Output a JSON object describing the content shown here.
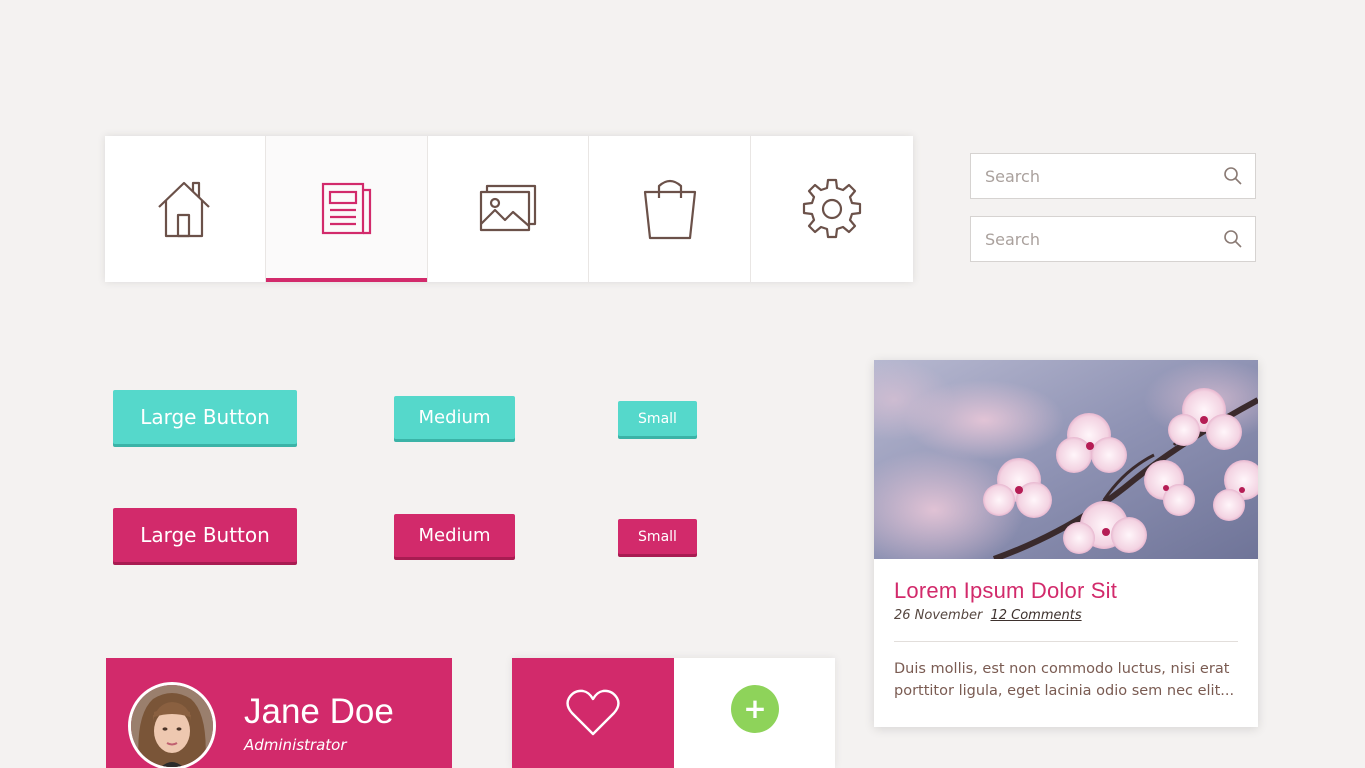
{
  "nav": {
    "accent_color": "#d22a6b",
    "icon_color": "#6b5149",
    "active_tab": 1,
    "tabs": [
      {
        "icon": "home-icon"
      },
      {
        "icon": "news-icon"
      },
      {
        "icon": "image-icon"
      },
      {
        "icon": "shopping-bag-icon"
      },
      {
        "icon": "gear-icon"
      }
    ]
  },
  "search": [
    {
      "placeholder": "Search"
    },
    {
      "placeholder": "Search"
    }
  ],
  "buttons": {
    "teal_color": "#55d8cb",
    "pink_color": "#d22a6b",
    "teal": {
      "large": "Large Button",
      "medium": "Medium",
      "small": "Small"
    },
    "pink": {
      "large": "Large Button",
      "medium": "Medium",
      "small": "Small"
    }
  },
  "card": {
    "title": "Lorem Ipsum Dolor Sit",
    "date": "26 November",
    "comments": "12 Comments",
    "excerpt": "Duis mollis, est non commodo luctus, nisi erat porttitor ligula, eget lacinia odio sem nec elit..."
  },
  "profile": {
    "name": "Jane Doe",
    "role": "Administrator"
  },
  "widget": {
    "like_icon": "heart-icon",
    "add_label": "+",
    "add_color": "#8ed35a"
  }
}
